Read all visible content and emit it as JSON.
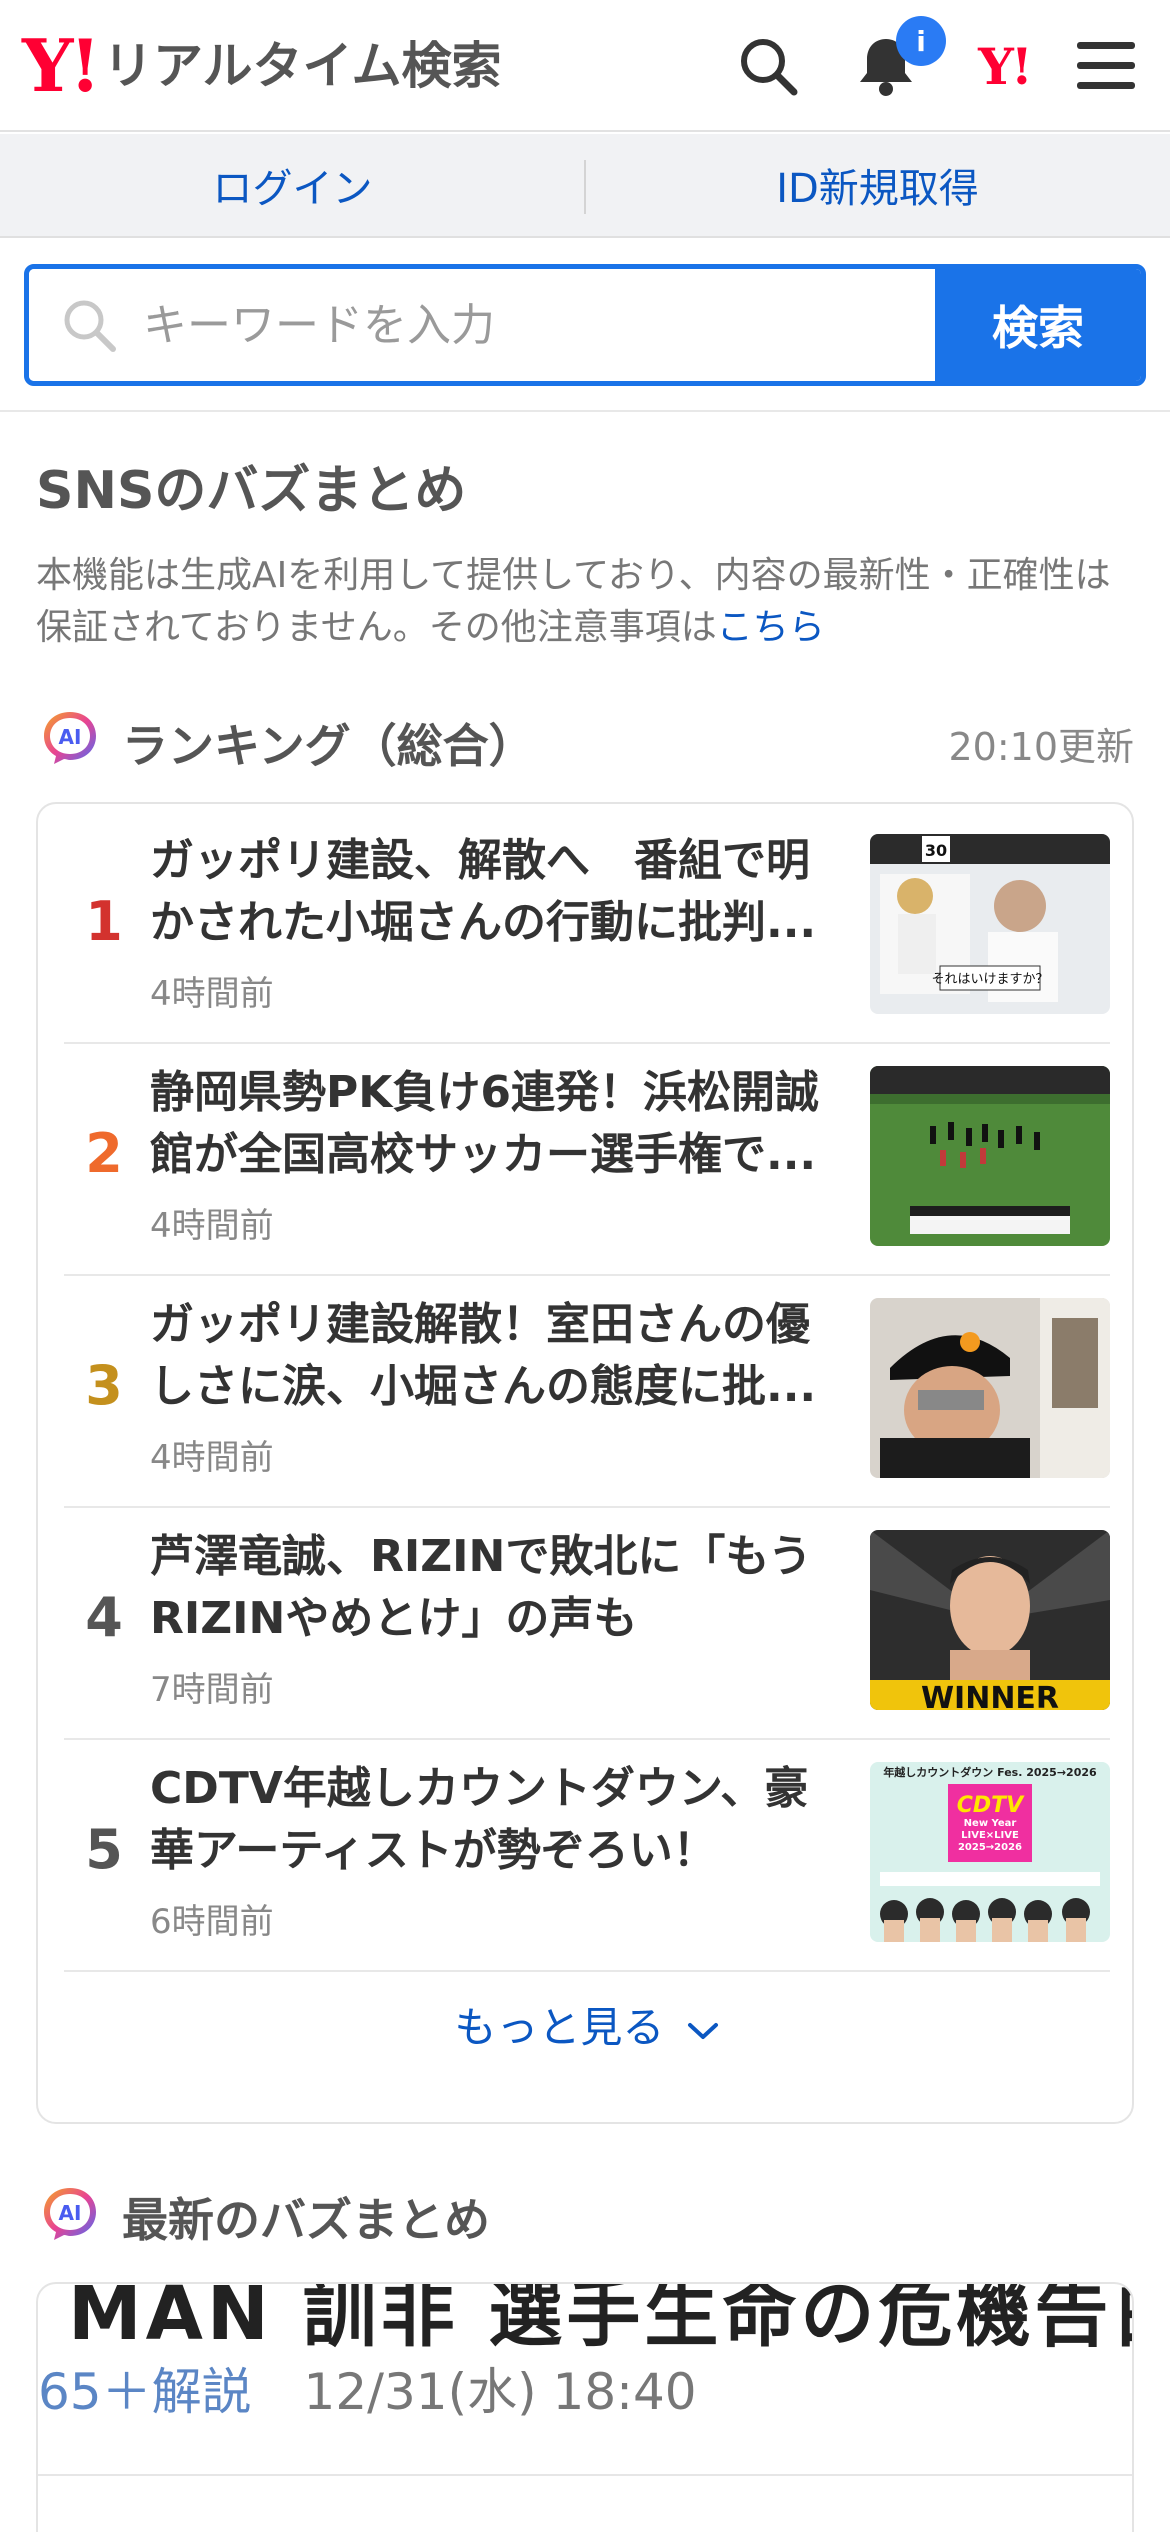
{
  "header": {
    "logo_mark": "Y!",
    "logo_text": "リアルタイム検索",
    "notification_badge": "i",
    "yahoo_mark": "Y!"
  },
  "login_bar": {
    "login": "ログイン",
    "register": "ID新規取得"
  },
  "search": {
    "placeholder": "キーワードを入力",
    "button": "検索"
  },
  "sns": {
    "title": "SNSのバズまとめ",
    "description": "本機能は生成AIを利用して提供しており、内容の最新性・正確性は保証されておりません。その他注意事項は",
    "link": "こちら"
  },
  "ranking": {
    "ai_label": "AI",
    "title": "ランキング（総合）",
    "updated": "20:10更新",
    "items": [
      {
        "rank": "1",
        "rank_color": "#d3322e",
        "title": "ガッポリ建設、解散へ　番組で明かされた小堀さんの行動に批判...",
        "time": "4時間前"
      },
      {
        "rank": "2",
        "rank_color": "#ef6a2c",
        "title": "静岡県勢PK負け6連発！浜松開誠館が全国高校サッカー選手権で...",
        "time": "4時間前"
      },
      {
        "rank": "3",
        "rank_color": "#c4901d",
        "title": "ガッポリ建設解散！室田さんの優しさに涙、小堀さんの態度に批...",
        "time": "4時間前"
      },
      {
        "rank": "4",
        "rank_color": "#555555",
        "title": "芦澤竜誠、RIZINで敗北に「もうRIZINやめとけ」の声も",
        "time": "7時間前"
      },
      {
        "rank": "5",
        "rank_color": "#555555",
        "title": "CDTV年越しカウントダウン、豪華アーティストが勢ぞろい！",
        "time": "6時間前"
      }
    ],
    "more": "もっと見る"
  },
  "latest": {
    "ai_label": "AI",
    "title": "最新のバズまとめ",
    "card_headline": "MAN 訓非 選手生命の危機告白",
    "card_count": "65＋解説",
    "card_date": "12/31(水) 18:40"
  },
  "thumbnails": {
    "t1_caption": "それはいけますか？",
    "t1_badge": "30",
    "t4_text": "WINNER",
    "t5_top": "年越しカウントダウン Fes. 2025→2026",
    "t5_logo": "CDTV",
    "t5_sub": "New Year LIVE×LIVE 2025→2026"
  }
}
